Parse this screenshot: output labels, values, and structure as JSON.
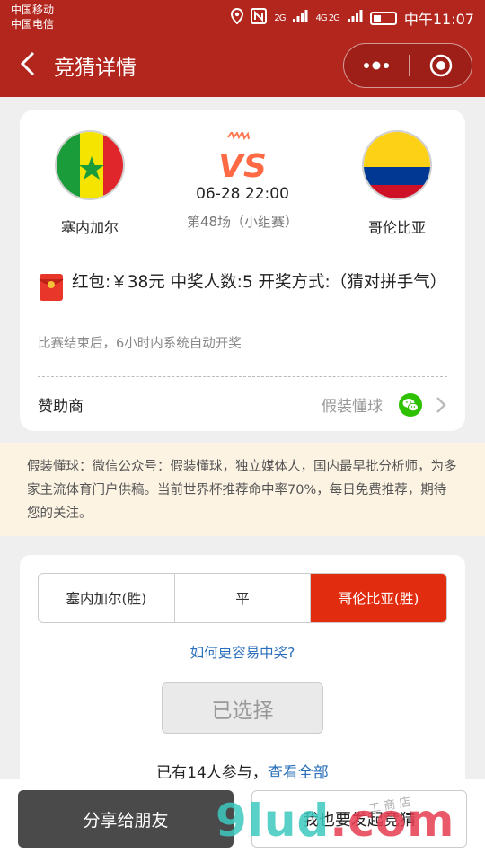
{
  "status_bar": {
    "carrier_1": "中国移动",
    "carrier_2": "中国电信",
    "network_1": "2G",
    "network_2": "4G 2G",
    "time": "中午11:07"
  },
  "header": {
    "title": "竞猜详情",
    "bg_color": "#b3261e"
  },
  "match": {
    "home_team": "塞内加尔",
    "away_team": "哥伦比亚",
    "time": "06-28 22:00",
    "info": "第48场（小组赛）",
    "prize_text": "红包:￥38元 中奖人数:5 开奖方式:（猜对拼手气）",
    "auto_note": "比赛结束后，6小时内系统自动开奖",
    "sponsor_label": "赞助商",
    "sponsor_name": "假装懂球"
  },
  "notice": {
    "text": "假装懂球：微信公众号：假装懂球，独立媒体人，国内最早批分析师，为多家主流体育门户供稿。当前世界杯推荐命中率70%，每日免费推荐，期待您的关注。"
  },
  "pick": {
    "options": [
      {
        "label": "塞内加尔(胜)",
        "selected": false
      },
      {
        "label": "平",
        "selected": false
      },
      {
        "label": "哥伦比亚(胜)",
        "selected": true
      }
    ],
    "howto_link": "如何更容易中奖?",
    "chosen_label": "已选择",
    "participants_text": "已有14人参与，",
    "view_all_link": "查看全部",
    "accent_color": "#e22c0f"
  },
  "bottom": {
    "share_label": "分享给朋友",
    "start_label": "我也要发起竞猜"
  },
  "watermark": {
    "main": "9lud",
    "tld": ".com",
    "sub": "工 商 店"
  }
}
